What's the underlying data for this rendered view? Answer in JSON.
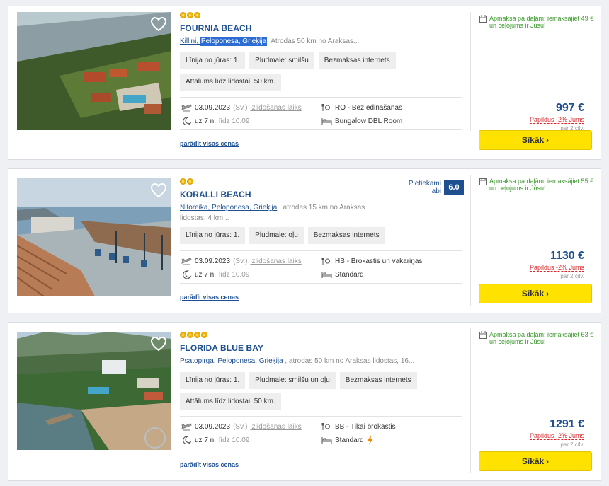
{
  "hotels": [
    {
      "name": "FOURNIA BEACH",
      "stars": 3,
      "loc_city": "Killini",
      "loc_region": "Peloponesa, Grieķija",
      "loc_rest": ", Atrodas  50 km no Araksas...",
      "tags": [
        "Līnija no jūras: 1.",
        "Pludmale: smilšu",
        "Bezmaksas internets",
        "Attālums līdz lidostai: 50 km."
      ],
      "date": "03.09.2023",
      "date_note": "(Sv.)",
      "date_link": "izlidošanas laiks",
      "nights": "uz 7 n.",
      "until": "līdz 10.09",
      "board": "RO - Bez ēdināšanas",
      "room": "Bungalow DBL Room",
      "show_all": "parādīt visas cenas",
      "promo": "Apmaksa pa daļām: iemaksājiet 49 € un ceļojums ir Jūsu!",
      "price": "997 €",
      "discount": "Papildus -2% Jums",
      "per": "par 2 cilv.",
      "button": "Sīkāk"
    },
    {
      "name": "KORALLI BEACH",
      "stars": 2,
      "loc_city": "Nitoreika",
      "loc_region": "Peloponesa, Grieķija",
      "loc_rest": " , atrodas 15 km no Araksas lidostas, 4 km...",
      "tags": [
        "Līnija no jūras: 1.",
        "Pludmale: oļu",
        "Bezmaksas internets"
      ],
      "rating_label": "Pietiekami labi",
      "rating_score": "6.0",
      "date": "03.09.2023",
      "date_note": "(Sv.)",
      "date_link": "izlidošanas laiks",
      "nights": "uz 7 n.",
      "until": "līdz 10.09",
      "board": "HB - Brokastis un vakariņas",
      "room": "Standard",
      "show_all": "parādīt visas cenas",
      "promo": "Apmaksa pa daļām: iemaksājiet 55 € un ceļojums ir Jūsu!",
      "price": "1130 €",
      "discount": "Papildus -2% Jums",
      "per": "par 2 cilv.",
      "button": "Sīkāk"
    },
    {
      "name": "FLORIDA BLUE BAY",
      "stars": 4,
      "loc_city": "Psatopirga",
      "loc_region": "Peloponesa, Grieķija",
      "loc_rest": " , atrodas 50 km no Araksas lidostas, 16...",
      "tags": [
        "Līnija no jūras: 1.",
        "Pludmale: smilšu un oļu",
        "Bezmaksas internets",
        "Attālums līdz lidostai: 50 km."
      ],
      "date": "03.09.2023",
      "date_note": "(Sv.)",
      "date_link": "izlidošanas laiks",
      "nights": "uz 7 n.",
      "until": "līdz 10.09",
      "board": "BB - Tikai brokastis",
      "room": "Standard",
      "show_all": "parādīt visas cenas",
      "promo": "Apmaksa pa daļām: iemaksājiet 63 € un ceļojums ir Jūsu!",
      "price": "1291 €",
      "discount": "Papildus -2% Jums",
      "per": "par 2 cilv.",
      "button": "Sīkāk"
    }
  ],
  "colors": {
    "brand": "#1d4f91",
    "button": "#ffe200",
    "promo": "#3a9a2a",
    "discount": "#d9262a",
    "star": "#f2b705"
  },
  "icons": [
    "heart-icon",
    "plane-icon",
    "moon-icon",
    "meal-icon",
    "bed-icon",
    "calendar-icon",
    "chevron-right-icon",
    "lightning-icon"
  ]
}
